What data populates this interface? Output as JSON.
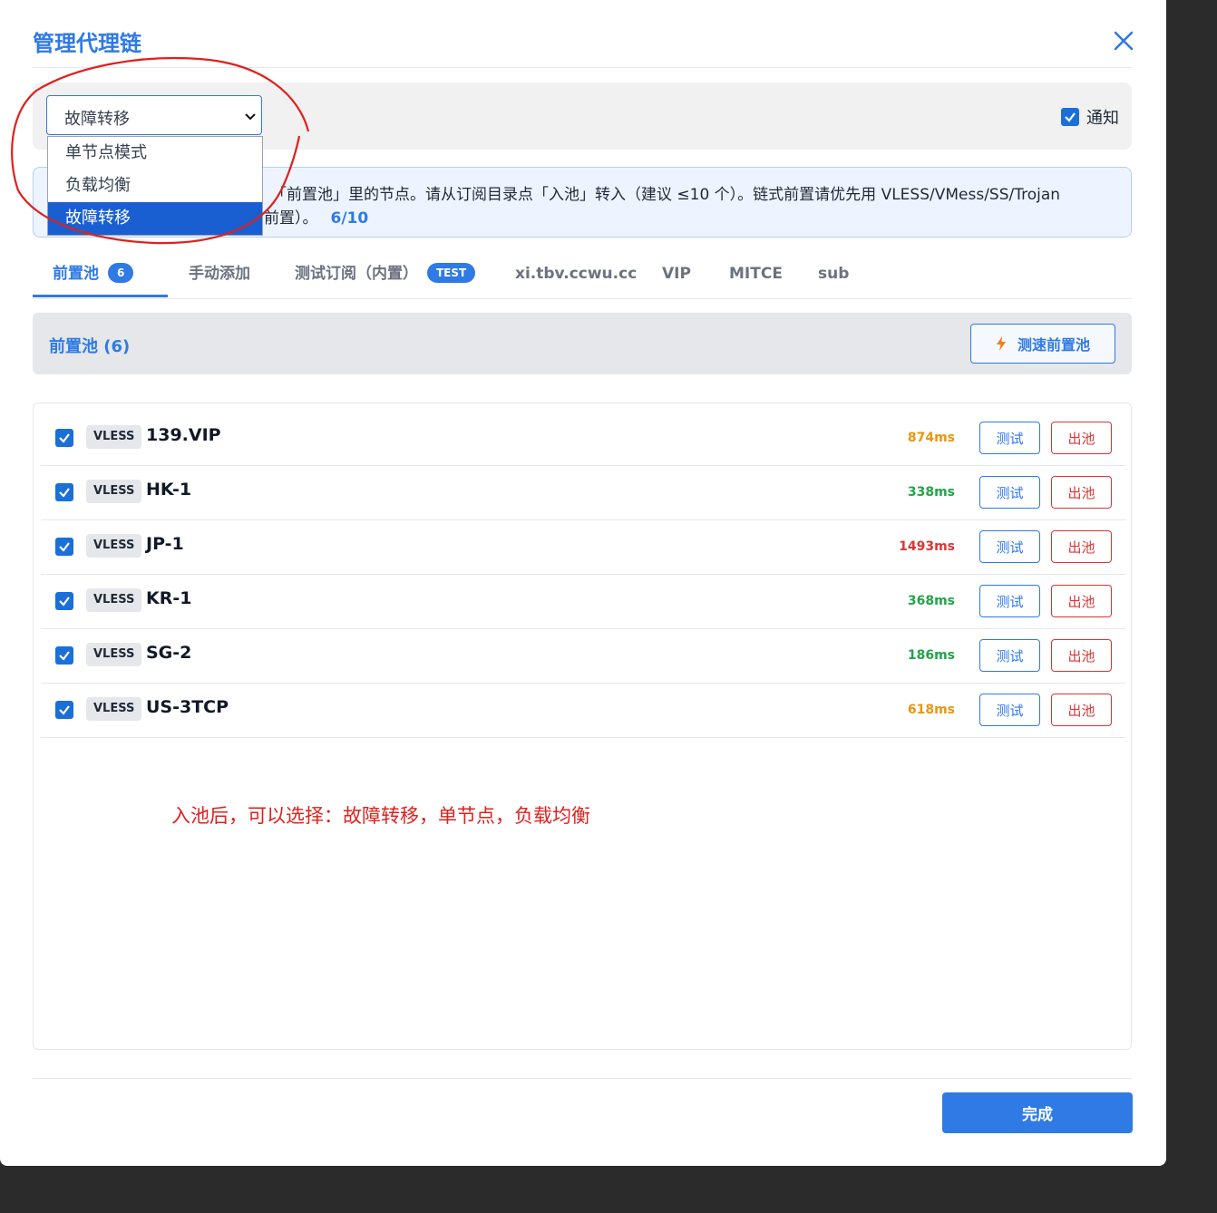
{
  "modal": {
    "title": "管理代理链",
    "close_icon": "close-icon"
  },
  "mode": {
    "selected": "故障转移",
    "options": [
      "单节点模式",
      "负载均衡",
      "故障转移"
    ],
    "selected_index": 2
  },
  "notify": {
    "label": "通知",
    "checked": true
  },
  "info": {
    "line1": "「前置池」里的节点。请从订阅目录点「入池」转入（建议 ≤10 个）。链式前置请优先用 VLESS/VMess/SS/Trojan",
    "line2": "前置）。",
    "count": "6/10"
  },
  "tabs": [
    {
      "label": "前置池",
      "badge": "6",
      "active": true
    },
    {
      "label": "手动添加"
    },
    {
      "label": "测试订阅（内置）",
      "badge": "TEST"
    },
    {
      "label": "xi.tbv.ccwu.cc"
    },
    {
      "label": "VIP"
    },
    {
      "label": "MITCE"
    },
    {
      "label": "sub"
    }
  ],
  "pool": {
    "title": "前置池 (6)",
    "speed_button": "测速前置池",
    "speed_icon": "lightning-icon"
  },
  "nodes": [
    {
      "protocol": "VLESS",
      "name": "139.VIP",
      "latency": "874ms",
      "latency_color": "#e8960f",
      "checked": true
    },
    {
      "protocol": "VLESS",
      "name": "HK-1",
      "latency": "338ms",
      "latency_color": "#22a34a",
      "checked": true
    },
    {
      "protocol": "VLESS",
      "name": "JP-1",
      "latency": "1493ms",
      "latency_color": "#dc3535",
      "checked": true
    },
    {
      "protocol": "VLESS",
      "name": "KR-1",
      "latency": "368ms",
      "latency_color": "#22a34a",
      "checked": true
    },
    {
      "protocol": "VLESS",
      "name": "SG-2",
      "latency": "186ms",
      "latency_color": "#22a34a",
      "checked": true
    },
    {
      "protocol": "VLESS",
      "name": "US-3TCP",
      "latency": "618ms",
      "latency_color": "#e8960f",
      "checked": true
    }
  ],
  "row_actions": {
    "test": "测试",
    "remove": "出池"
  },
  "annotation": {
    "text": "入池后，可以选择：故障转移，单节点，负载均衡",
    "color": "#e0201d"
  },
  "footer": {
    "done": "完成"
  },
  "colors": {
    "accent": "#2f7ae5",
    "danger": "#dc3535"
  }
}
